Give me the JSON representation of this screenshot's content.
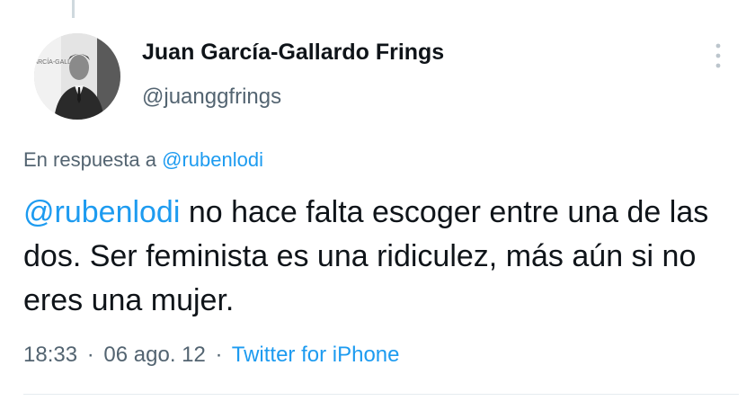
{
  "tweet": {
    "author_name": "Juan García-Gallardo Frings",
    "author_handle": "@juanggfrings",
    "reply_prefix": "En respuesta a",
    "reply_to": "@rubenlodi",
    "body_mention": "@rubenlodi",
    "body_text": " no hace falta escoger entre una de las dos. Ser feminista es una ridiculez, más aún si no eres una mujer.",
    "time": "18:33",
    "separator": "·",
    "date": "06 ago. 12",
    "source": "Twitter for iPhone",
    "avatar_backdrop_text": "GARCÍA-GALL"
  },
  "icons": {
    "more": "more-vertical-icon"
  },
  "colors": {
    "link": "#1d9bf0",
    "secondary_text": "#536471",
    "primary_text": "#0f1419"
  }
}
